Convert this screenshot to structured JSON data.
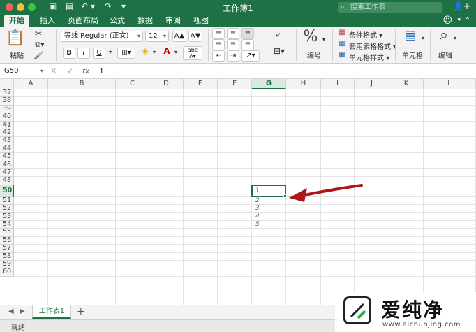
{
  "window": {
    "title": "工作簿1",
    "search_placeholder": "搜索工作表"
  },
  "tabs": [
    "开始",
    "插入",
    "页面布局",
    "公式",
    "数据",
    "审阅",
    "视图"
  ],
  "ribbon": {
    "paste_label": "粘贴",
    "font_name": "等线 Regular (正文)",
    "font_size": "12",
    "grow_font": "A▲",
    "shrink_font": "A▼",
    "bold": "B",
    "italic": "I",
    "underline": "U",
    "number_symbol": "%",
    "number_label": "编号",
    "conditional_format": "条件格式",
    "table_format": "套用表格格式",
    "cell_styles": "单元格样式",
    "cells_label": "单元格",
    "editing_label": "编辑"
  },
  "formula_bar": {
    "name_box": "G50",
    "value": "1"
  },
  "grid": {
    "columns": [
      "A",
      "B",
      "C",
      "D",
      "E",
      "F",
      "G",
      "H",
      "I",
      "J",
      "K",
      "L"
    ],
    "selected_column": "G",
    "rows": [
      "37",
      "38",
      "39",
      "40",
      "41",
      "42",
      "43",
      "44",
      "45",
      "46",
      "47",
      "48",
      "50",
      "51",
      "52",
      "53",
      "54",
      "55",
      "56",
      "57",
      "58",
      "59",
      "60"
    ],
    "selected_row": "50",
    "cell_values": [
      {
        "row": "50",
        "col": "G",
        "value": "1"
      },
      {
        "row": "51",
        "col": "G",
        "value": "2"
      },
      {
        "row": "52",
        "col": "G",
        "value": "3"
      },
      {
        "row": "53",
        "col": "G",
        "value": "4"
      },
      {
        "row": "54",
        "col": "G",
        "value": "5"
      }
    ]
  },
  "sheet_tabs": {
    "active": "工作表1",
    "add_label": "+"
  },
  "status": "就绪",
  "watermark": {
    "brand": "爱纯净",
    "url": "www.aichunjing.com"
  },
  "colors": {
    "accent": "#1e7145",
    "arrow": "#b01616"
  }
}
